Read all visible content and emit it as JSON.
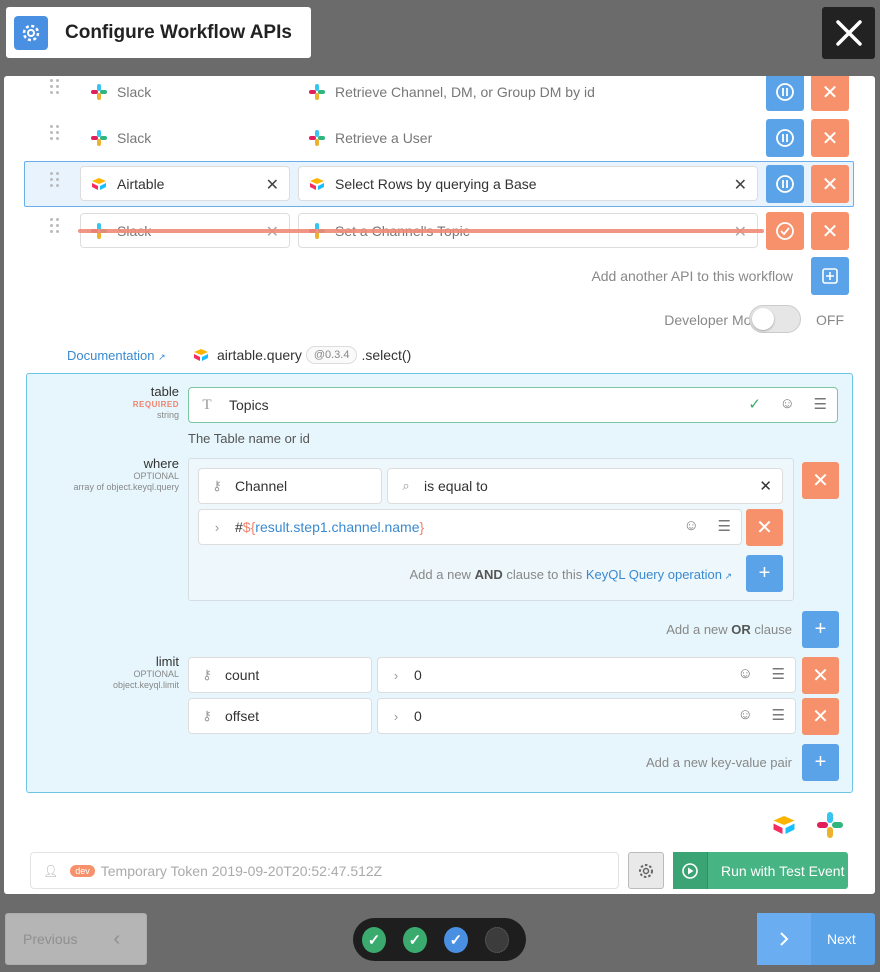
{
  "header": {
    "title": "Configure Workflow APIs"
  },
  "workflow": {
    "apis": [
      {
        "service": "Slack",
        "method": "Retrieve Channel, DM, or Group DM by id"
      },
      {
        "service": "Slack",
        "method": "Retrieve a User"
      },
      {
        "service": "Airtable",
        "method": "Select Rows by querying a Base"
      },
      {
        "service": "Slack",
        "method": "Set a Channel's Topic"
      }
    ],
    "add_api_label": "Add another API to this workflow",
    "developer_mode_label": "Developer Mode",
    "developer_mode_state": "OFF"
  },
  "doc": {
    "link_label": "Documentation",
    "service": "airtable.query",
    "version": "@0.3.4",
    "method": ".select()"
  },
  "params": {
    "table": {
      "name": "table",
      "requirement": "REQUIRED",
      "type": "string",
      "value": "Topics",
      "description": "The Table name or id"
    },
    "where": {
      "name": "where",
      "requirement": "OPTIONAL",
      "type": "array of object.keyql.query",
      "key": "Channel",
      "operator": "is equal to",
      "value_prefix": "#",
      "value_dollar": "$",
      "value_open": "{",
      "value_expr": "result.step1.channel.name",
      "value_close": "}",
      "add_and_pre": "Add a new",
      "add_and_bold": "AND",
      "add_and_mid": "clause to this",
      "add_and_link": "KeyQL Query operation",
      "add_or_pre": "Add a new",
      "add_or_bold": "OR",
      "add_or_post": "clause"
    },
    "limit": {
      "name": "limit",
      "requirement": "OPTIONAL",
      "type": "object.keyql.limit",
      "rows": [
        {
          "key": "count",
          "value": "0"
        },
        {
          "key": "offset",
          "value": "0"
        }
      ],
      "add_label": "Add a new key-value pair"
    }
  },
  "footer": {
    "token_badge": "dev",
    "token_label": "Temporary Token 2019-09-20T20:52:47.512Z",
    "run_label": "Run with Test Event"
  },
  "nav": {
    "previous_label": "Previous",
    "next_label": "Next"
  },
  "colors": {
    "accent": "#5ba3e8",
    "danger": "#f6916b",
    "success": "#46b483"
  }
}
